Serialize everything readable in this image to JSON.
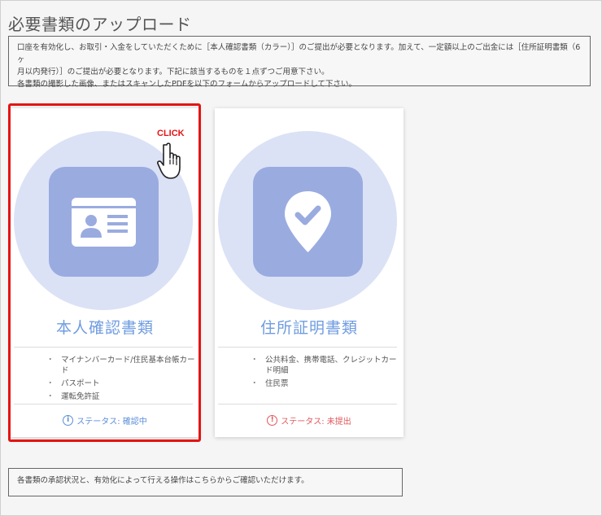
{
  "page": {
    "title": "必要書類のアップロード"
  },
  "notice": {
    "line1": "口座を有効化し、お取引・入金をしていただくために［本人確認書類（カラー）］のご提出が必要となります。加えて、一定額以上のご出金には［住所証明書類（6ヶ",
    "line2": "月以内発行）］のご提出が必要となります。下記に該当するものを１点ずつご用意下さい。",
    "line3": "各書類の撮影した画像、またはスキャンしたPDFを以下のフォームからアップロードして下さい。"
  },
  "cards": [
    {
      "title": "本人確認書類",
      "icon": "id-card-icon",
      "items": [
        "マイナンバーカード/住民基本台帳カード",
        "パスポート",
        "運転免許証"
      ],
      "status": "ステータス: 確認中",
      "status_icon": "info-icon",
      "status_color": "#5b8ed8",
      "highlighted": true
    },
    {
      "title": "住所証明書類",
      "icon": "location-check-icon",
      "items": [
        "公共料金、携帯電話、クレジットカード明細",
        "住民票"
      ],
      "status": "ステータス: 未提出",
      "status_icon": "alert-icon",
      "status_color": "#e0575b",
      "highlighted": false
    }
  ],
  "annotation": {
    "click_label": "CLICK",
    "highlight_color": "#e41414"
  },
  "footer": {
    "note": "各書類の承認状況と、有効化によって行える操作はこちらからご確認いただけます。"
  }
}
